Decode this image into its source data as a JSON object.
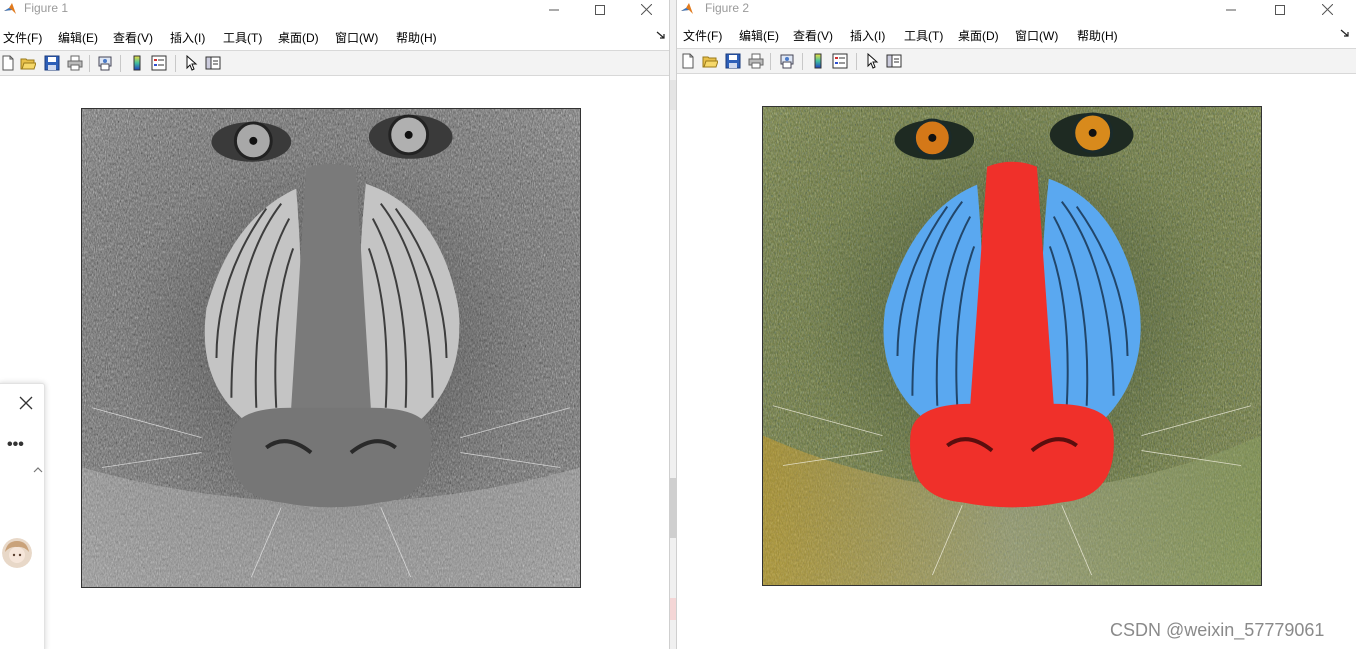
{
  "figure1": {
    "title": "Figure 1",
    "menu": [
      "文件(F)",
      "编辑(E)",
      "查看(V)",
      "插入(I)",
      "工具(T)",
      "桌面(D)",
      "窗口(W)",
      "帮助(H)"
    ]
  },
  "figure2": {
    "title": "Figure 2",
    "menu": [
      "文件(F)",
      "编辑(E)",
      "查看(V)",
      "插入(I)",
      "工具(T)",
      "桌面(D)",
      "窗口(W)",
      "帮助(H)"
    ]
  },
  "toolbar_icons": [
    "new-figure-icon",
    "open-file-icon",
    "save-icon",
    "print-icon",
    "print-preview-icon",
    "colorbar-icon",
    "legend-icon",
    "pointer-icon",
    "property-editor-icon"
  ],
  "images": {
    "left": {
      "content": "grayscale mandrill",
      "colormap": "gray"
    },
    "right": {
      "content": "color mandrill",
      "colormap": "rgb"
    }
  },
  "chat_panel": {
    "dots": "•••"
  },
  "watermark": "CSDN @weixin_57779061",
  "colors": {
    "toolbar_bg": "#f3f3f3",
    "nose_red": "#f0302a",
    "cheek_blue": "#5aa8f0",
    "fur_gold": "#b9a23a"
  }
}
